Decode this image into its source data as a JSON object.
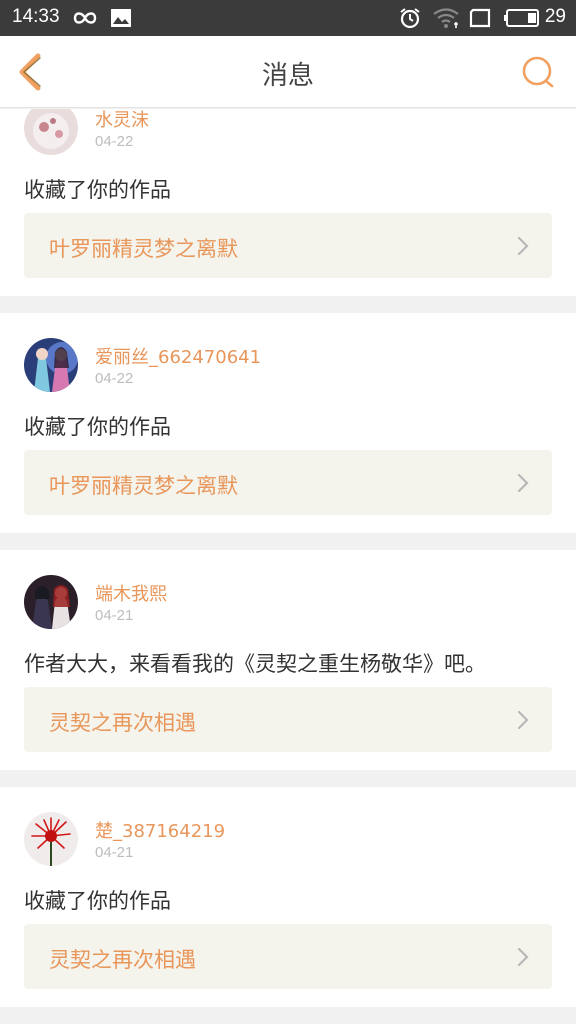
{
  "status_bar": {
    "time": "14:33",
    "battery_level": "29",
    "icons": [
      "infinity-icon",
      "image-icon",
      "alarm-icon",
      "wifi-icon",
      "screen-icon",
      "battery-icon"
    ]
  },
  "app_bar": {
    "title": "消息",
    "accent_color": "#f0a060"
  },
  "messages": [
    {
      "username": "水灵沫",
      "date": "04-22",
      "text": "收藏了你的作品",
      "work_title": "叶罗丽精灵梦之离默"
    },
    {
      "username": "爱丽丝_662470641",
      "date": "04-22",
      "text": "收藏了你的作品",
      "work_title": "叶罗丽精灵梦之离默"
    },
    {
      "username": "端木我熙",
      "date": "04-21",
      "text": "作者大大，来看看我的《灵契之重生杨敬华》吧。",
      "work_title": "灵契之再次相遇"
    },
    {
      "username": "楚_387164219",
      "date": "04-21",
      "text": "收藏了你的作品",
      "work_title": "灵契之再次相遇"
    }
  ]
}
